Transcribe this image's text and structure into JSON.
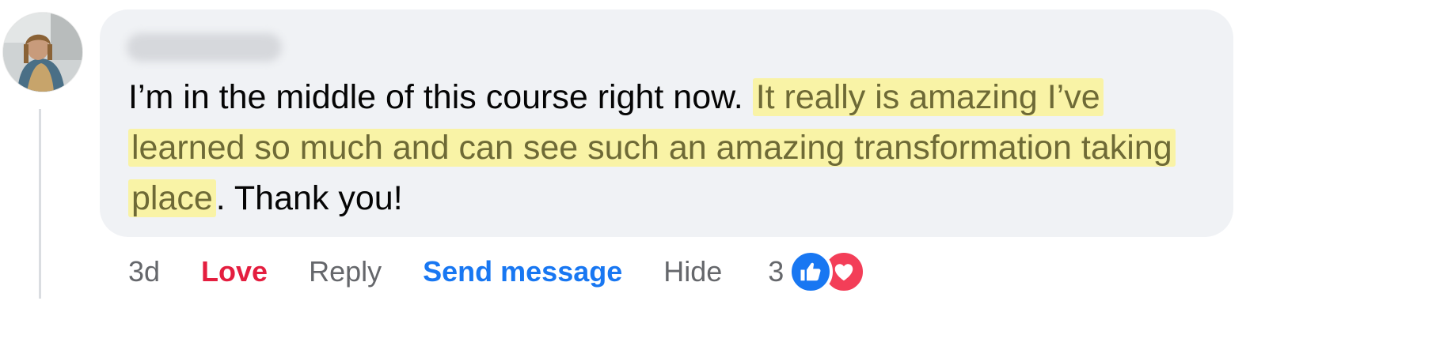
{
  "comment": {
    "author_name": "",
    "text_before": "I’m in the middle of this course right now. ",
    "text_highlight_1": "It really is amazing I’ve learned so much and can see such an amazing transformation taking place",
    "text_after": ". Thank you!"
  },
  "actions": {
    "time": "3d",
    "love": "Love",
    "reply": "Reply",
    "send_message": "Send message",
    "hide": "Hide",
    "reaction_count": "3"
  },
  "reactions": {
    "icons": [
      "like-icon",
      "love-icon"
    ]
  },
  "colors": {
    "bubble": "#f0f2f5",
    "highlight": "#f9f3a6",
    "love": "#e41e3f",
    "link_blue": "#1877f2",
    "like_icon": "#1877f2",
    "love_icon": "#f33e58",
    "meta_text": "#65676b"
  }
}
